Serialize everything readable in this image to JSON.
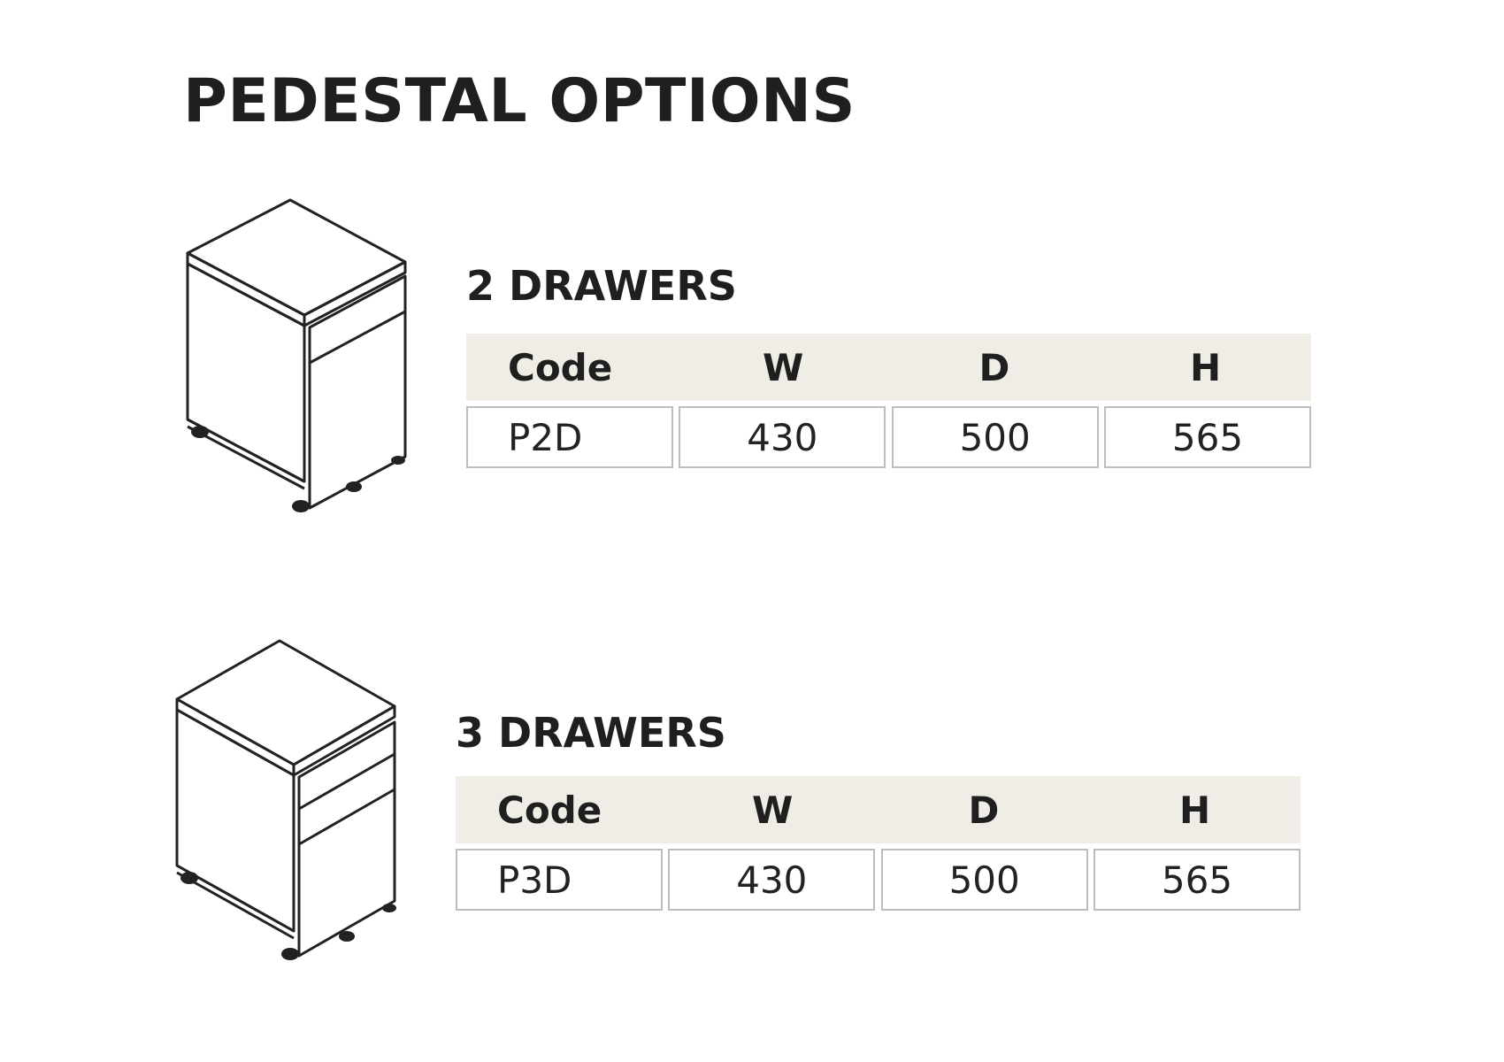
{
  "page": {
    "title": "PEDESTAL OPTIONS"
  },
  "sections": [
    {
      "heading": "2 DRAWERS",
      "drawers": 2,
      "headers": [
        "Code",
        "W",
        "D",
        "H"
      ],
      "row": [
        "P2D",
        "430",
        "500",
        "565"
      ]
    },
    {
      "heading": "3 DRAWERS",
      "drawers": 3,
      "headers": [
        "Code",
        "W",
        "D",
        "H"
      ],
      "row": [
        "P3D",
        "430",
        "500",
        "565"
      ]
    }
  ],
  "colors": {
    "header_bg": "#efede6",
    "cell_border": "#bdbdbd",
    "text": "#1f1f1f",
    "line": "#222222"
  }
}
